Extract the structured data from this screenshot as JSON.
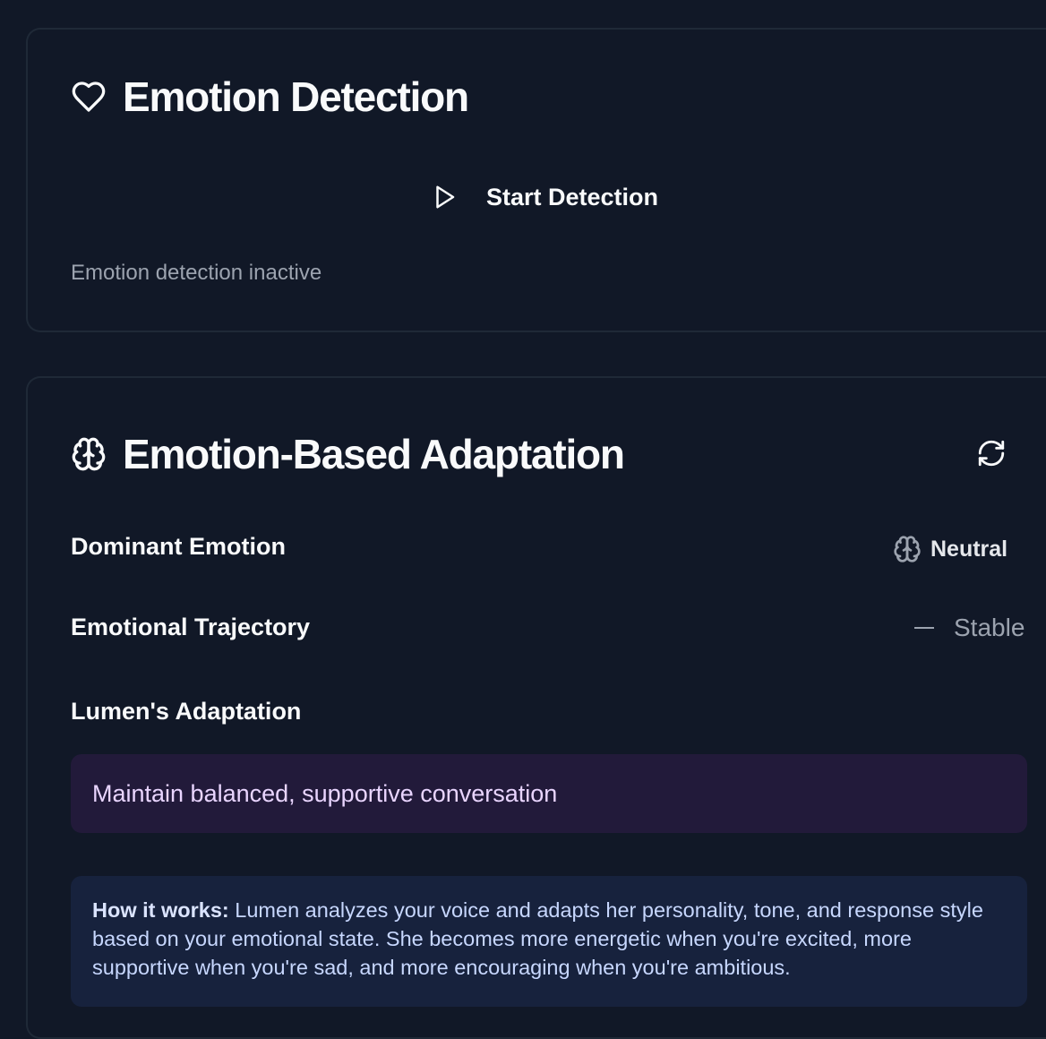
{
  "detection": {
    "title": "Emotion Detection",
    "start_button_label": "Start Detection",
    "status_text": "Emotion detection inactive"
  },
  "adaptation": {
    "title": "Emotion-Based Adaptation",
    "dominant_emotion_label": "Dominant Emotion",
    "dominant_emotion_value": "Neutral",
    "trajectory_label": "Emotional Trajectory",
    "trajectory_value": "Stable",
    "lumen_adaptation_label": "Lumen's Adaptation",
    "lumen_adaptation_text": "Maintain balanced, supportive conversation",
    "how_it_works_heading": "How it works:",
    "how_it_works_text": " Lumen analyzes your voice and adapts her personality, tone, and response style based on your emotional state. She becomes more energetic when you're excited, more supportive when you're sad, and more encouraging when you're ambitious."
  },
  "icons": {
    "detection_title_icon": "heart-icon",
    "start_icon": "play-icon",
    "adaptation_title_icon": "brain-icon",
    "refresh_icon": "refresh-icon",
    "emotion_icon": "brain-icon"
  },
  "colors": {
    "background": "#111827",
    "card_border": "#1f2937",
    "adaptation_box": "#221a3a",
    "info_box": "#17223d",
    "muted_text": "#9ca3af"
  }
}
